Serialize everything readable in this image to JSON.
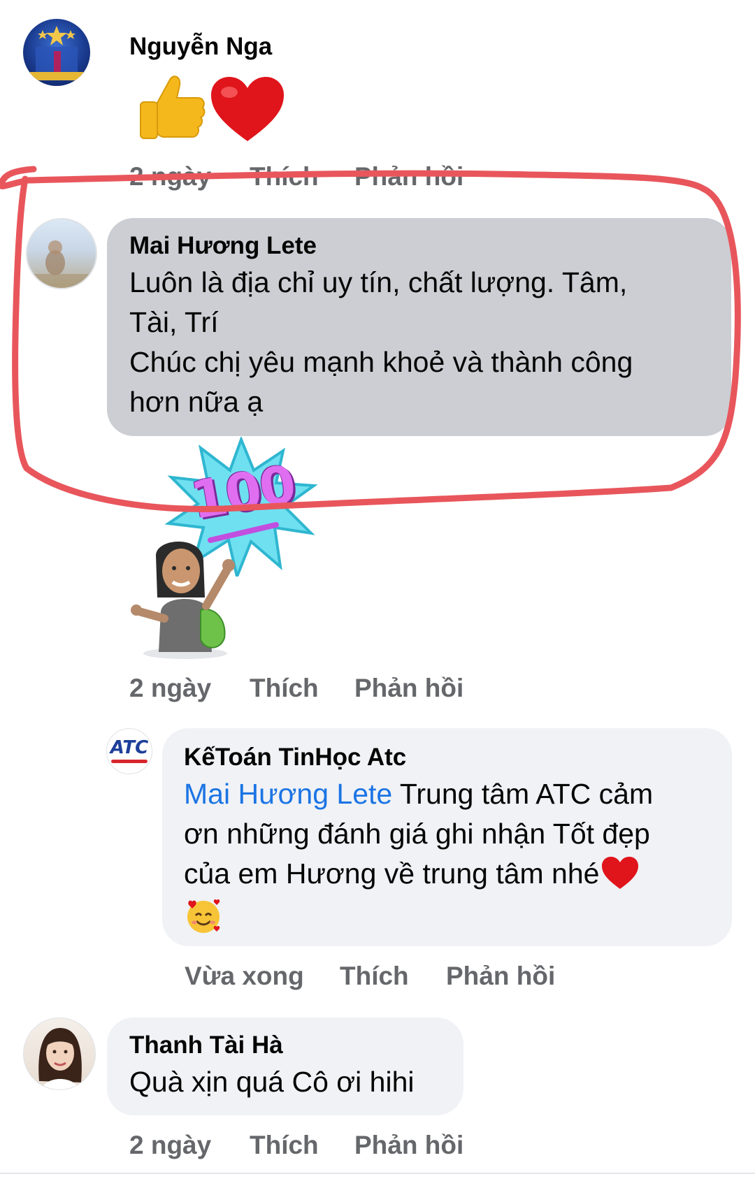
{
  "comments": [
    {
      "author": "Nguyễn Nga",
      "time": "2 ngày",
      "like_label": "Thích",
      "reply_label": "Phản hồi",
      "reactions": [
        "thumbs-up-icon",
        "red-heart-icon"
      ]
    },
    {
      "author": "Mai Hương Lete",
      "text_line1": "Luôn là địa chỉ uy tín, chất lượng. Tâm,",
      "text_line2": "Tài, Trí",
      "text_line3": "Chúc chị yêu mạnh khoẻ và thành công",
      "text_line4": "hơn nữa ạ",
      "sticker_text": "100",
      "time": "2 ngày",
      "like_label": "Thích",
      "reply_label": "Phản hồi"
    },
    {
      "author": "KếToán TinHọc Atc",
      "avatar_text": "ATC",
      "mention": "Mai Hương Lete",
      "text_line1": " Trung tâm ATC cảm",
      "text_line2": "ơn những đánh giá ghi nhận Tốt đẹp",
      "text_line3": "của em Hương về trung tâm nhé",
      "time": "Vừa xong",
      "like_label": "Thích",
      "reply_label": "Phản hồi"
    },
    {
      "author": "Thanh Tài Hà",
      "text_line1": "Quà xịn quá Cô ơi hihi",
      "time": "2 ngày",
      "like_label": "Thích",
      "reply_label": "Phản hồi"
    }
  ],
  "colors": {
    "bubble_gray": "#ccced3",
    "bubble_light": "#f0f2f5",
    "meta_text": "#65676b",
    "mention_blue": "#1b74e4",
    "highlight_red": "#e8565c"
  }
}
